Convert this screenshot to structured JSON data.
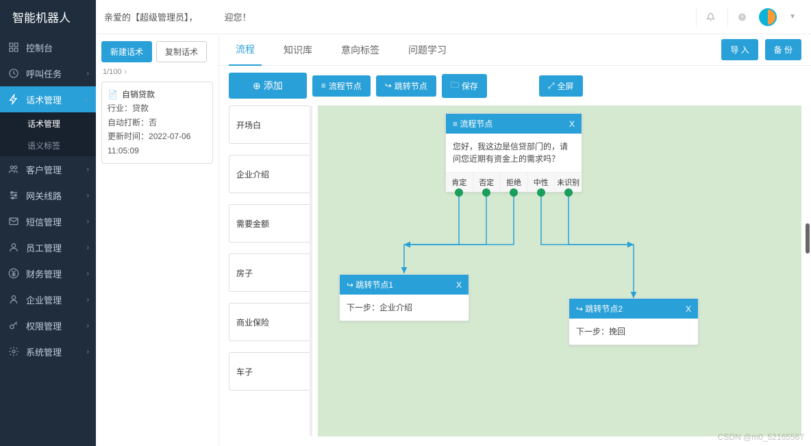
{
  "app_title": "智能机器人",
  "welcome": "亲爱的【超级管理员】，   迎您！",
  "sidebar": {
    "items": [
      {
        "icon": "dashboard",
        "label": "控制台",
        "chev": false
      },
      {
        "icon": "clock",
        "label": "呼叫任务",
        "chev": true
      },
      {
        "icon": "bolt",
        "label": "话术管理",
        "chev": true,
        "active": true
      },
      {
        "icon": "users",
        "label": "客户管理",
        "chev": true
      },
      {
        "icon": "sliders",
        "label": "网关线路",
        "chev": true
      },
      {
        "icon": "mail",
        "label": "短信管理",
        "chev": true
      },
      {
        "icon": "user",
        "label": "员工管理",
        "chev": true
      },
      {
        "icon": "yen",
        "label": "财务管理",
        "chev": true
      },
      {
        "icon": "user2",
        "label": "企业管理",
        "chev": true
      },
      {
        "icon": "key",
        "label": "权限管理",
        "chev": true
      },
      {
        "icon": "gear",
        "label": "系统管理",
        "chev": true
      }
    ],
    "sub": [
      {
        "label": "话术管理",
        "sel": true
      },
      {
        "label": "语义标签",
        "sel": false
      }
    ]
  },
  "col2": {
    "new_btn": "新建话术",
    "copy_btn": "复制话术",
    "pager": "1/100",
    "card": {
      "title": "自销贷款",
      "industry_label": "行业：",
      "industry": "贷款",
      "auto_label": "自动打断：",
      "auto": "否",
      "update_label": "更新时间：",
      "update": "2022-07-06 11:05:09"
    }
  },
  "tabs": [
    {
      "label": "流程",
      "active": true
    },
    {
      "label": "知识库"
    },
    {
      "label": "意向标签"
    },
    {
      "label": "问题学习"
    }
  ],
  "tab_actions": {
    "import": "导 入",
    "backup": "备 份"
  },
  "toolbar": {
    "add": "添加",
    "flow_node": "流程节点",
    "jump_node": "跳转节点",
    "save": "保存",
    "fullscreen": "全屏"
  },
  "nodelist": [
    "开场白",
    "企业介绍",
    "需要金额",
    "房子",
    "商业保险",
    "车子"
  ],
  "flow": {
    "main_node": {
      "title": "流程节点",
      "close": "X",
      "body": "您好，我这边是信贷部门的，请问您近期有资金上的需求吗？",
      "tags": [
        "肯定",
        "否定",
        "拒绝",
        "中性",
        "未识别"
      ]
    },
    "jump1": {
      "title": "跳转节点1",
      "close": "X",
      "next_label": "下一步：",
      "next": "企业介绍"
    },
    "jump2": {
      "title": "跳转节点2",
      "close": "X",
      "next_label": "下一步：",
      "next": "挽回"
    }
  },
  "watermark": "CSDN @m0_52165567"
}
